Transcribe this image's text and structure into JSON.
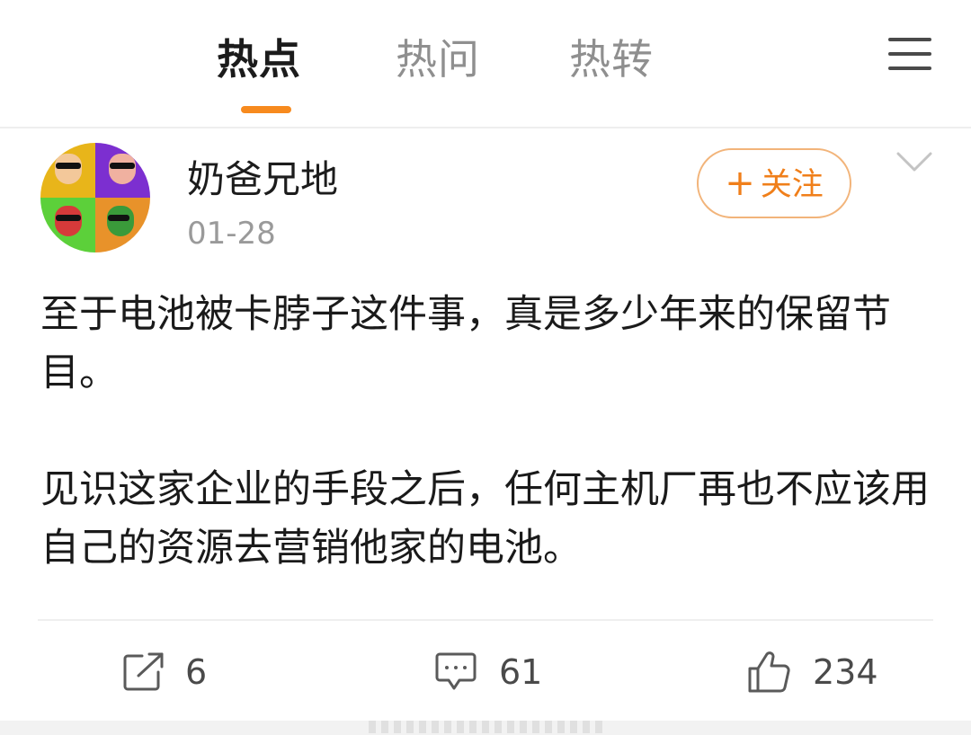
{
  "tabs": [
    {
      "label": "热点",
      "active": true
    },
    {
      "label": "热问",
      "active": false
    },
    {
      "label": "热转",
      "active": false
    }
  ],
  "accent_color": "#f78a1e",
  "menu_icon": "hamburger-menu-icon",
  "post": {
    "username": "奶爸兄地",
    "time": "01-28",
    "follow_label": "关注",
    "follow_prefix": "+",
    "paragraphs": [
      "至于电池被卡脖子这件事，真是多少年来的保留节目。",
      "见识这家企业的手段之后，任何主机厂再也不应该用自己的资源去营销他家的电池。"
    ]
  },
  "actions": {
    "repost": {
      "icon": "repost-icon",
      "count": "6"
    },
    "comment": {
      "icon": "comment-icon",
      "count": "61"
    },
    "like": {
      "icon": "thumbs-up-icon",
      "count": "234"
    }
  }
}
